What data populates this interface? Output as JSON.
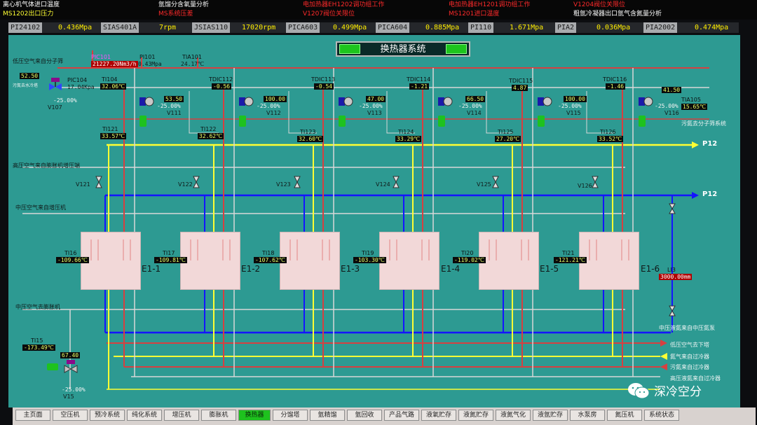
{
  "alarms": [
    {
      "text": "离心机气体进口温度",
      "color": "#ffffff"
    },
    {
      "text": "氩馏分含氧量分析",
      "color": "#ffffff"
    },
    {
      "text": "电加热器EH1202调功组工作",
      "color": "#ff2a2a"
    },
    {
      "text": "电加热器EH1201调功组工作",
      "color": "#ff2a2a"
    },
    {
      "text": "V1204阀位关限位",
      "color": "#ff2a2a"
    },
    {
      "text": "MS1202出口压力",
      "color": "#ffff33"
    },
    {
      "text": "MS系统压差",
      "color": "#ff2a2a"
    },
    {
      "text": "V1207阀位关限位",
      "color": "#ff2a2a"
    },
    {
      "text": "MS1201进口温度",
      "color": "#ff2a2a"
    },
    {
      "text": "粗氩冷凝器出口氩气含氮量分析",
      "color": "#ffffff"
    }
  ],
  "tag_bar": [
    {
      "name": "PI24102",
      "value": "0.436Mpa"
    },
    {
      "name": "SIAS401A",
      "value": "7rpm"
    },
    {
      "name": "JSIAS110",
      "value": "17020rpm"
    },
    {
      "name": "PICA603",
      "value": "0.499Mpa"
    },
    {
      "name": "PICA604",
      "value": "0.885Mpa"
    },
    {
      "name": "PI110",
      "value": "1.671Mpa"
    },
    {
      "name": "PIA2",
      "value": "0.036Mpa"
    },
    {
      "name": "PIA2002",
      "value": "0.474Mpa"
    }
  ],
  "title": "换热器系统",
  "labels": {
    "low_in": "低压空气来自分子筛",
    "high_in": "高压空气来自膨胀机增压端",
    "mid_in": "中压空气来自增压机",
    "mid_out": "中压空气去膨胀机",
    "waste_n2_out": "污氮去分子筛系统",
    "liq_n2_in": "中压液氮来自中压氮泵",
    "low_out": "低压空气去下塔",
    "n2_in": "氮气来自过冷器",
    "waste_in": "污氮来自过冷器",
    "last_in": "高压液氮来自过冷器",
    "p12_a": "P12",
    "p12_b": "P12",
    "small_left": "污氮去水冷塔"
  },
  "top_instruments": [
    {
      "tag": "PIC101",
      "value": "21227.20Nm3/h",
      "alarm": true
    },
    {
      "tag": "PI101",
      "value": "0.43Mpa",
      "alarm": false
    },
    {
      "tag": "TIA101",
      "value": "24.17℃",
      "alarm": false
    }
  ],
  "pic104": {
    "tag": "PIC104",
    "value": "17.04Kpa",
    "sp": "52.50",
    "pct": "-25.00%",
    "valve": "V107"
  },
  "temp_tags": [
    {
      "tag": "TI104",
      "value": "32.06℃"
    },
    {
      "tag": "TI121",
      "value": "33.57℃"
    },
    {
      "tag": "TDIC112",
      "value": "-0.56"
    },
    {
      "tag": "TI122",
      "value": "32.62℃"
    },
    {
      "tag": "TDIC113",
      "value": "-0.54"
    },
    {
      "tag": "TI123",
      "value": "32.60℃"
    },
    {
      "tag": "TDIC114",
      "value": "-1.21"
    },
    {
      "tag": "TI124",
      "value": "33.29℃"
    },
    {
      "tag": "TDIC115",
      "value": "4.87"
    },
    {
      "tag": "TI125",
      "value": "27.20℃"
    },
    {
      "tag": "TDIC116",
      "value": "-1.46"
    },
    {
      "tag": "TI126",
      "value": "33.52℃"
    },
    {
      "tag": "TIA105",
      "value": "15.65℃"
    }
  ],
  "valves": [
    {
      "sp": "53.50",
      "pct": "-25.00%",
      "name": "V111"
    },
    {
      "sp": "100.00",
      "pct": "-25.00%",
      "name": "V112"
    },
    {
      "sp": "47.00",
      "pct": "-25.00%",
      "name": "V113"
    },
    {
      "sp": "66.50",
      "pct": "-25.00%",
      "name": "V114"
    },
    {
      "sp": "100.00",
      "pct": "-25.00%",
      "name": "V115"
    },
    {
      "sp": "41.50",
      "pct": "-25.00%",
      "name": "V116"
    }
  ],
  "hand_valves": [
    "V121",
    "V122",
    "V123",
    "V124",
    "V125",
    "V126"
  ],
  "exchangers": [
    {
      "name": "E1-1",
      "tag": "TI16",
      "value": "-109.66℃"
    },
    {
      "name": "E1-2",
      "tag": "TI17",
      "value": "-109.81℃"
    },
    {
      "name": "E1-3",
      "tag": "TI18",
      "value": "-107.62℃"
    },
    {
      "name": "E1-4",
      "tag": "TI19",
      "value": "-103.30℃"
    },
    {
      "name": "E1-5",
      "tag": "TI20",
      "value": "-119.02℃"
    },
    {
      "name": "E1-6",
      "tag": "TI21",
      "value": "-121.21℃"
    }
  ],
  "li3": {
    "tag": "LI3",
    "value": "3000.00mm"
  },
  "ti15": {
    "tag": "TI15",
    "value": "-173.49℃"
  },
  "v15": {
    "sp": "67.40",
    "pct": "-25.00%",
    "name": "V15"
  },
  "nav": [
    "主页面",
    "空压机",
    "预冷系统",
    "纯化系统",
    "增压机",
    "膨胀机",
    "换热器",
    "分馏塔",
    "氩精馏",
    "氩回收",
    "产品气路",
    "液氧贮存",
    "液氮贮存",
    "液氮气化",
    "液氩贮存",
    "水泵房",
    "氮压机",
    "系统状态"
  ],
  "nav_active": 6,
  "watermark": "深冷空分",
  "colors": {
    "background": "#2d9a92",
    "pipe_red": "#d64040",
    "pipe_yellow": "#ffff33",
    "pipe_blue": "#1414ff",
    "pipe_white": "#d8d8d8",
    "exchanger": "#f2d8d8"
  }
}
